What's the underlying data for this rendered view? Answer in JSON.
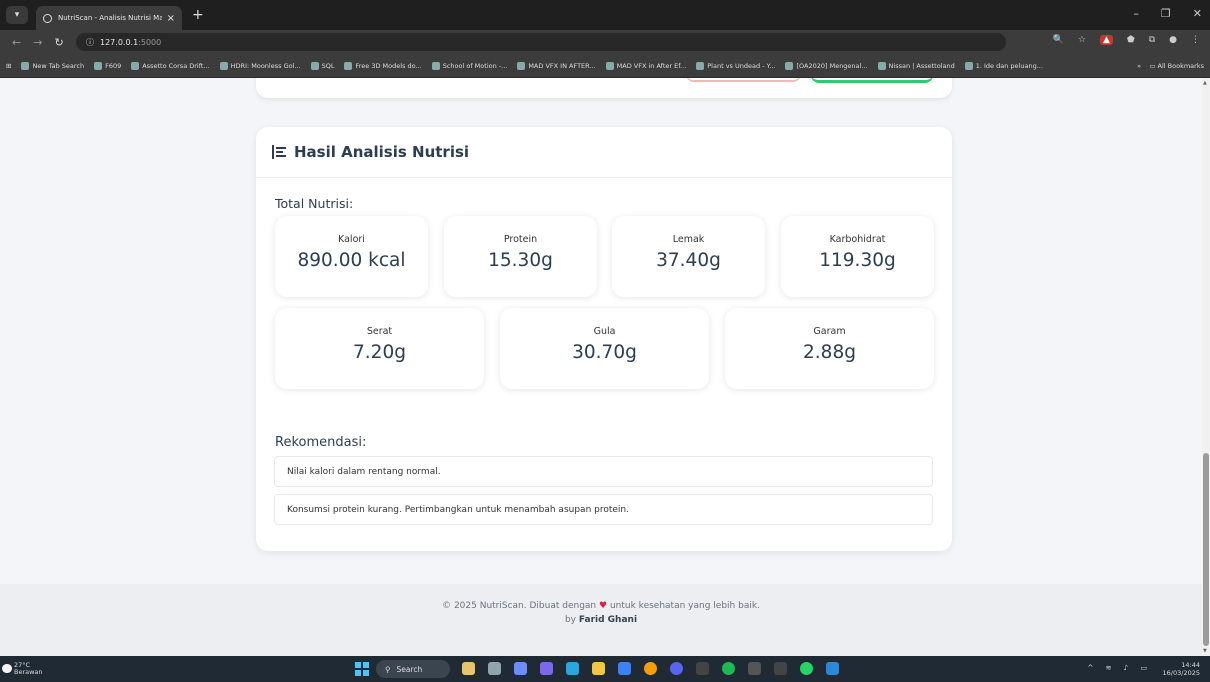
{
  "browser": {
    "tab_title": "NutriScan - Analisis Nutrisi Mal",
    "new_tab": "+",
    "url": "127.0.0.1",
    "url_port": ":5000",
    "bookmarks": [
      "New Tab Search",
      "F609",
      "Assetto Corsa Drift...",
      "HDRI: Moonless Gol...",
      "SQL",
      "Free 3D Models do...",
      "School of Motion -...",
      "MAD VFX IN AFTER...",
      "MAD VFX in After Ef...",
      "Plant vs Undead - Y...",
      "[OA2020] Mengenal...",
      "Nissan | Assettoland",
      "1. Ide dan peluang..."
    ],
    "all_bookmarks": "All Bookmarks",
    "more_bookmarks": "»"
  },
  "card": {
    "title": "Hasil Analisis Nutrisi",
    "total_label": "Total Nutrisi:",
    "stats_row1": [
      {
        "label": "Kalori",
        "value": "890.00 kcal"
      },
      {
        "label": "Protein",
        "value": "15.30g"
      },
      {
        "label": "Lemak",
        "value": "37.40g"
      },
      {
        "label": "Karbohidrat",
        "value": "119.30g"
      }
    ],
    "stats_row2": [
      {
        "label": "Serat",
        "value": "7.20g"
      },
      {
        "label": "Gula",
        "value": "30.70g"
      },
      {
        "label": "Garam",
        "value": "2.88g"
      }
    ],
    "rec_label": "Rekomendasi:",
    "recommendations": [
      "Nilai kalori dalam rentang normal.",
      "Konsumsi protein kurang. Pertimbangkan untuk menambah asupan protein."
    ]
  },
  "footer": {
    "line1_pre": "© 2025 NutriScan. Dibuat dengan",
    "heart": "♥",
    "line1_post": "untuk kesehatan yang lebih baik.",
    "by": "by",
    "author": "Farid Ghani"
  },
  "taskbar": {
    "temp": "27°C",
    "weather": "Berawan",
    "search": "Search",
    "time": "14:44",
    "date": "16/03/2025"
  },
  "colors": {
    "accent": "#2ecc71",
    "heading": "#2c3e50",
    "heart": "#e11d48"
  }
}
